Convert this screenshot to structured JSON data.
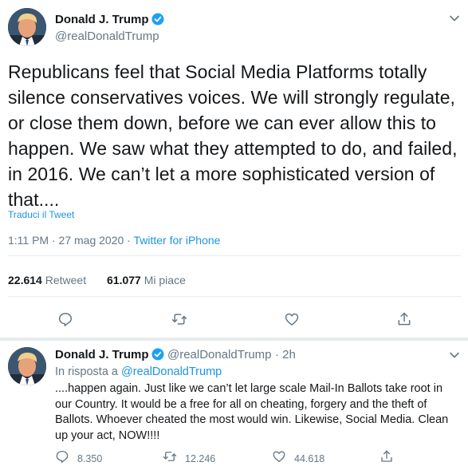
{
  "tweet": {
    "author_name": "Donald J. Trump",
    "author_handle": "@realDonaldTrump",
    "text": "Republicans feel that Social Media Platforms totally silence conservatives voices. We will strongly regulate, or close them down, before we can ever allow this to happen. We saw what they attempted to do, and failed, in 2016. We can’t let a more sophisticated version of that....",
    "translate_label": "Traduci il Tweet",
    "timestamp": "1:11 PM · 27 mag 2020",
    "separator": " · ",
    "source": "Twitter for iPhone",
    "retweets_count": "22.614",
    "retweets_label": "Retweet",
    "likes_count": "61.077",
    "likes_label": "Mi piace",
    "actions": [
      "reply-icon",
      "retweet-icon",
      "like-icon",
      "share-icon"
    ]
  },
  "reply": {
    "author_name": "Donald J. Trump",
    "author_handle": "@realDonaldTrump",
    "time": "· 2h",
    "in_reply_prefix": "In risposta a ",
    "in_reply_handle": "@realDonaldTrump",
    "text": "....happen again. Just like we can’t let large scale Mail-In Ballots take root in our Country. It would be a free for all on cheating, forgery and the theft of Ballots. Whoever cheated the most would win. Likewise, Social Media. Clean up your act, NOW!!!!",
    "reply_count": "8.350",
    "retweet_count": "12.246",
    "like_count": "44.618"
  },
  "colors": {
    "accent": "#1b95e0",
    "verified": "#1da1f2",
    "muted": "#657786",
    "text": "#14171a",
    "divider": "#e6ecf0"
  }
}
